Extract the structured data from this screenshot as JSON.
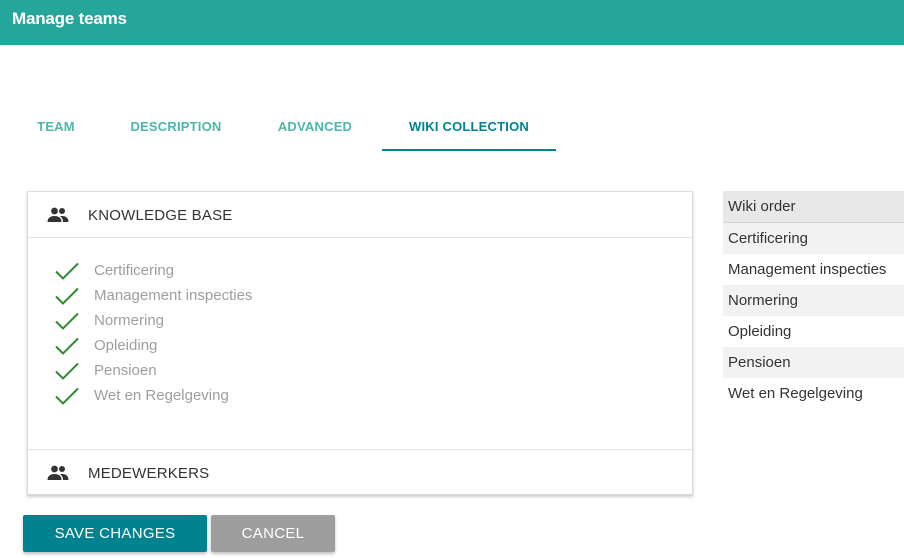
{
  "header": {
    "title": "Manage teams"
  },
  "tabs": [
    {
      "label": "TEAM",
      "active": false
    },
    {
      "label": "DESCRIPTION",
      "active": false
    },
    {
      "label": "ADVANCED",
      "active": false
    },
    {
      "label": "WIKI COLLECTION",
      "active": true
    }
  ],
  "panel": {
    "sections": [
      {
        "label": "KNOWLEDGE BASE",
        "icon": "people-icon",
        "expanded": true
      },
      {
        "label": "MEDEWERKERS",
        "icon": "people-icon",
        "expanded": false
      }
    ],
    "items": [
      {
        "label": "Certificering",
        "checked": true
      },
      {
        "label": "Management inspecties",
        "checked": true
      },
      {
        "label": "Normering",
        "checked": true
      },
      {
        "label": "Opleiding",
        "checked": true
      },
      {
        "label": "Pensioen",
        "checked": true
      },
      {
        "label": "Wet en Regelgeving",
        "checked": true
      }
    ]
  },
  "wiki_order": {
    "title": "Wiki order",
    "items": [
      "Certificering",
      "Management inspecties",
      "Normering",
      "Opleiding",
      "Pensioen",
      "Wet en Regelgeving"
    ]
  },
  "actions": {
    "save_label": "SAVE CHANGES",
    "cancel_label": "CANCEL"
  },
  "colors": {
    "header": "#26a69a",
    "accent": "#00838f",
    "check": "#2e8b2e",
    "cancel": "#9e9e9e"
  }
}
